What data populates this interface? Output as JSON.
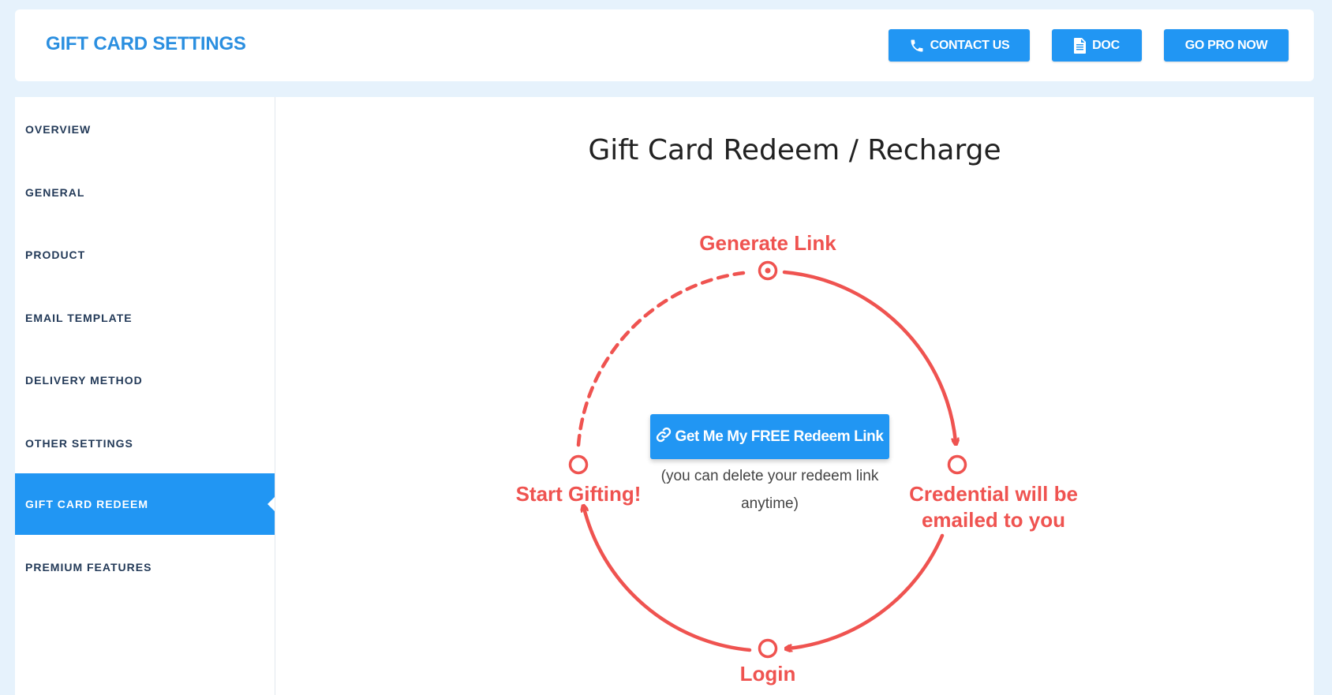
{
  "header": {
    "title": "GIFT CARD SETTINGS",
    "buttons": {
      "contact": "CONTACT US",
      "doc": "DOC",
      "pro": "GO PRO NOW"
    }
  },
  "sidebar": {
    "items": [
      {
        "label": "OVERVIEW"
      },
      {
        "label": "GENERAL"
      },
      {
        "label": "PRODUCT"
      },
      {
        "label": "EMAIL TEMPLATE"
      },
      {
        "label": "DELIVERY METHOD"
      },
      {
        "label": "OTHER SETTINGS"
      },
      {
        "label": "GIFT CARD REDEEM",
        "active": true
      },
      {
        "label": "PREMIUM FEATURES"
      }
    ]
  },
  "main": {
    "title": "Gift Card Redeem / Recharge",
    "diagram": {
      "generate": "Generate Link",
      "credential_line1": "Credential will be",
      "credential_line2": "emailed to you",
      "login": "Login",
      "start": "Start Gifting!"
    },
    "redeem_button": "Get Me My FREE Redeem Link",
    "redeem_note": "(you can delete your redeem link anytime)"
  },
  "colors": {
    "accent": "#2196f3",
    "diagram": "#ef5350",
    "sidebar_text": "#233a58"
  }
}
